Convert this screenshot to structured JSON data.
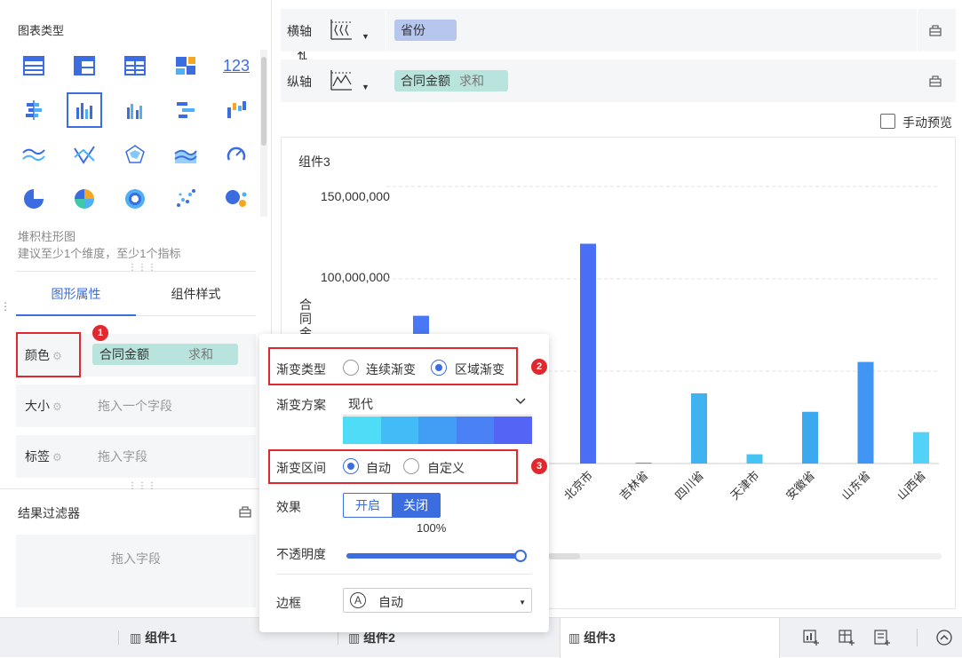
{
  "left_panel": {
    "chart_type_title": "图表类型",
    "chart_icons": [
      "table-icon",
      "cross-table-icon",
      "detail-table-icon",
      "treemap-icon",
      "kpi-icon",
      "stacked-bar-icon",
      "stacked-column-icon",
      "grouped-column-icon",
      "ranged-bar-icon",
      "waterfall-icon",
      "line-icon",
      "parallel-icon",
      "radar-icon",
      "area-icon",
      "gauge-icon",
      "pie-icon",
      "donut-icon",
      "rose-icon",
      "scatter-icon",
      "bubble-icon"
    ],
    "kpi_text": "123",
    "selected_chart_name": "堆积柱形图",
    "selected_chart_hint": "建议至少1个维度，至少1个指标",
    "tabs": [
      "图形属性",
      "组件样式"
    ],
    "props": {
      "color_label": "颜色",
      "color_field": "合同金额",
      "color_agg": "求和",
      "size_label": "大小",
      "size_placeholder": "拖入一个字段",
      "tag_label": "标签",
      "tag_placeholder": "拖入字段"
    },
    "filter_title": "结果过滤器",
    "filter_placeholder": "拖入字段"
  },
  "axes": {
    "x_label": "横轴",
    "x_field": "省份",
    "y_label": "纵轴",
    "y_field": "合同金额",
    "y_agg": "求和",
    "swap_icon": "⇅"
  },
  "manual_preview": "手动预览",
  "chart": {
    "component_title": "组件3",
    "ylabel_partial": "合同金",
    "yticks": [
      "150,000,000",
      "100,000,000"
    ]
  },
  "chart_data": {
    "type": "bar",
    "categories": [
      "北京市",
      "吉林省",
      "四川省",
      "天津市",
      "安徽省",
      "山东省",
      "山西省"
    ],
    "values": [
      119000000,
      500000,
      38000000,
      5000000,
      28000000,
      55000000,
      17000000
    ],
    "hidden_bar_value": 80000000,
    "ylim": [
      0,
      150000000
    ],
    "grid": true,
    "colors": [
      "#4a6ef5",
      "#4a9ef5",
      "#3fb3f0",
      "#45c3f2",
      "#3ca8f0",
      "#4395f3",
      "#52d2f7"
    ]
  },
  "popup": {
    "gradient_type_label": "渐变类型",
    "gradient_type_options": [
      "连续渐变",
      "区域渐变"
    ],
    "gradient_type_selected": "区域渐变",
    "scheme_label": "渐变方案",
    "scheme_value": "现代",
    "scheme_colors": [
      "#4fdcf7",
      "#43bbf7",
      "#429ef5",
      "#4a82f5",
      "#5465f5"
    ],
    "range_label": "渐变区间",
    "range_options": [
      "自动",
      "自定义"
    ],
    "range_selected": "自动",
    "effect_label": "效果",
    "effect_on": "开启",
    "effect_off": "关闭",
    "effect_selected": "关闭",
    "opacity_value": "100%",
    "opacity_fraction": 1.0,
    "opacity_label": "不透明度",
    "border_label": "边框",
    "border_value": "自动",
    "border_icon_letter": "A"
  },
  "annotations": {
    "badge1": "1",
    "badge2": "2",
    "badge3": "3"
  },
  "bottom_tabs": [
    "组件1",
    "组件2",
    "组件3"
  ],
  "accent": "#3b6de0"
}
